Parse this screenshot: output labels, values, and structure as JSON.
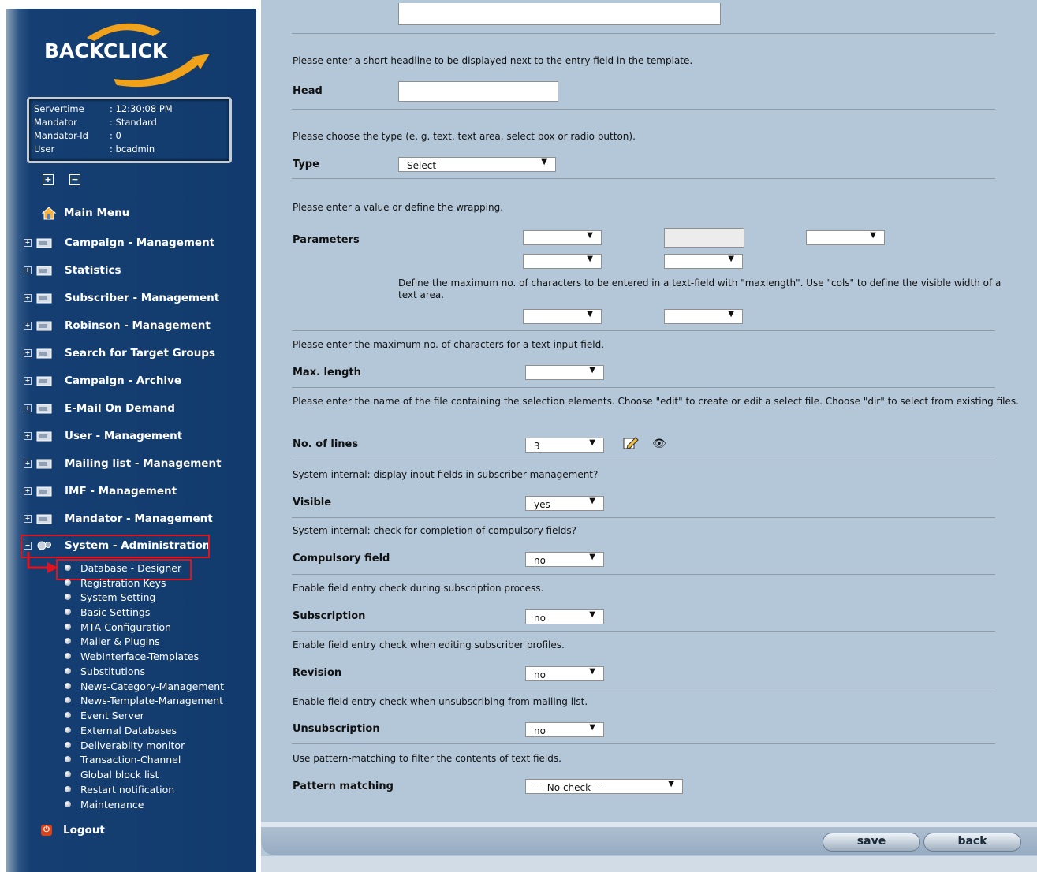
{
  "sidebar": {
    "logo_text": "BACKCLICK",
    "info": {
      "servertime_label": "Servertime",
      "servertime_value": ": 12:30:08 PM",
      "mandator_label": "Mandator",
      "mandator_value": ": Standard",
      "mandator_id_label": "Mandator-Id",
      "mandator_id_value": ": 0",
      "user_label": "User",
      "user_value": ": bcadmin"
    },
    "expand_all": "+",
    "collapse_all": "−",
    "main_menu": "Main Menu",
    "menus": [
      "Campaign - Management",
      "Statistics",
      "Subscriber - Management",
      "Robinson - Management",
      "Search for Target Groups",
      "Campaign - Archive",
      "E-Mail On Demand",
      "User - Management",
      "Mailing list - Management",
      "IMF - Management",
      "Mandator - Management",
      "System - Administration"
    ],
    "submenu": [
      "Database - Designer",
      "Registration Keys",
      "System Setting",
      "Basic Settings",
      "MTA-Configuration",
      "Mailer & Plugins",
      "WebInterface-Templates",
      "Substitutions",
      "News-Category-Management",
      "News-Template-Management",
      "Event Server",
      "External Databases",
      "Deliverabilty monitor",
      "Transaction-Channel",
      "Global block list",
      "Restart notification",
      "Maintenance"
    ],
    "logout": "Logout"
  },
  "form": {
    "head_desc": "Please enter a short headline to be displayed next to the entry field in the template.",
    "head_label": "Head",
    "head_value": "",
    "type_desc": "Please choose the type (e. g. text, text area, select box or radio button).",
    "type_label": "Type",
    "type_value": "Select",
    "param_desc": "Please enter a value or define the wrapping.",
    "param_label": "Parameters",
    "param_note": "Define the maximum no. of characters to be entered in a text-field with \"maxlength\". Use \"cols\" to define the visible width of a text area.",
    "maxlen_desc": "Please enter the maximum no. of characters for a text input field.",
    "maxlen_label": "Max. length",
    "lines_desc": "Please enter the name of the file containing the selection elements. Choose \"edit\" to create or edit a select file. Choose \"dir\" to select from existing files.",
    "lines_label": "No. of lines",
    "lines_value": "3",
    "visible_desc": "System internal: display input fields in subscriber management?",
    "visible_label": "Visible",
    "visible_value": "yes",
    "compulsory_desc": "System internal: check for completion of compulsory fields?",
    "compulsory_label": "Compulsory field",
    "compulsory_value": "no",
    "subscription_desc": "Enable field entry check during subscription process.",
    "subscription_label": "Subscription",
    "subscription_value": "no",
    "revision_desc": "Enable field entry check when editing subscriber profiles.",
    "revision_label": "Revision",
    "revision_value": "no",
    "unsub_desc": "Enable field entry check when unsubscribing from mailing list.",
    "unsub_label": "Unsubscription",
    "unsub_value": "no",
    "pattern_desc": "Use pattern-matching to filter the contents of text fields.",
    "pattern_label": "Pattern matching",
    "pattern_value": "--- No check ---"
  },
  "buttons": {
    "save": "save",
    "back": "back"
  },
  "colors": {
    "sidebar": "#153f72",
    "content": "#b4c7d8",
    "highlight": "#e0141e"
  }
}
